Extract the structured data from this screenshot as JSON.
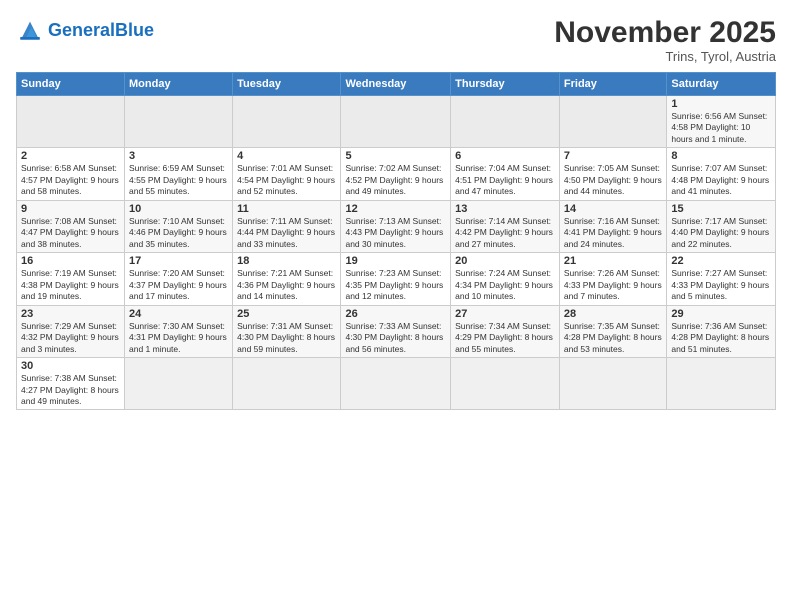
{
  "logo": {
    "line1": "General",
    "line2": "Blue"
  },
  "title": "November 2025",
  "subtitle": "Trins, Tyrol, Austria",
  "days_header": [
    "Sunday",
    "Monday",
    "Tuesday",
    "Wednesday",
    "Thursday",
    "Friday",
    "Saturday"
  ],
  "weeks": [
    [
      {
        "day": "",
        "info": ""
      },
      {
        "day": "",
        "info": ""
      },
      {
        "day": "",
        "info": ""
      },
      {
        "day": "",
        "info": ""
      },
      {
        "day": "",
        "info": ""
      },
      {
        "day": "",
        "info": ""
      },
      {
        "day": "1",
        "info": "Sunrise: 6:56 AM\nSunset: 4:58 PM\nDaylight: 10 hours\nand 1 minute."
      }
    ],
    [
      {
        "day": "2",
        "info": "Sunrise: 6:58 AM\nSunset: 4:57 PM\nDaylight: 9 hours\nand 58 minutes."
      },
      {
        "day": "3",
        "info": "Sunrise: 6:59 AM\nSunset: 4:55 PM\nDaylight: 9 hours\nand 55 minutes."
      },
      {
        "day": "4",
        "info": "Sunrise: 7:01 AM\nSunset: 4:54 PM\nDaylight: 9 hours\nand 52 minutes."
      },
      {
        "day": "5",
        "info": "Sunrise: 7:02 AM\nSunset: 4:52 PM\nDaylight: 9 hours\nand 49 minutes."
      },
      {
        "day": "6",
        "info": "Sunrise: 7:04 AM\nSunset: 4:51 PM\nDaylight: 9 hours\nand 47 minutes."
      },
      {
        "day": "7",
        "info": "Sunrise: 7:05 AM\nSunset: 4:50 PM\nDaylight: 9 hours\nand 44 minutes."
      },
      {
        "day": "8",
        "info": "Sunrise: 7:07 AM\nSunset: 4:48 PM\nDaylight: 9 hours\nand 41 minutes."
      }
    ],
    [
      {
        "day": "9",
        "info": "Sunrise: 7:08 AM\nSunset: 4:47 PM\nDaylight: 9 hours\nand 38 minutes."
      },
      {
        "day": "10",
        "info": "Sunrise: 7:10 AM\nSunset: 4:46 PM\nDaylight: 9 hours\nand 35 minutes."
      },
      {
        "day": "11",
        "info": "Sunrise: 7:11 AM\nSunset: 4:44 PM\nDaylight: 9 hours\nand 33 minutes."
      },
      {
        "day": "12",
        "info": "Sunrise: 7:13 AM\nSunset: 4:43 PM\nDaylight: 9 hours\nand 30 minutes."
      },
      {
        "day": "13",
        "info": "Sunrise: 7:14 AM\nSunset: 4:42 PM\nDaylight: 9 hours\nand 27 minutes."
      },
      {
        "day": "14",
        "info": "Sunrise: 7:16 AM\nSunset: 4:41 PM\nDaylight: 9 hours\nand 24 minutes."
      },
      {
        "day": "15",
        "info": "Sunrise: 7:17 AM\nSunset: 4:40 PM\nDaylight: 9 hours\nand 22 minutes."
      }
    ],
    [
      {
        "day": "16",
        "info": "Sunrise: 7:19 AM\nSunset: 4:38 PM\nDaylight: 9 hours\nand 19 minutes."
      },
      {
        "day": "17",
        "info": "Sunrise: 7:20 AM\nSunset: 4:37 PM\nDaylight: 9 hours\nand 17 minutes."
      },
      {
        "day": "18",
        "info": "Sunrise: 7:21 AM\nSunset: 4:36 PM\nDaylight: 9 hours\nand 14 minutes."
      },
      {
        "day": "19",
        "info": "Sunrise: 7:23 AM\nSunset: 4:35 PM\nDaylight: 9 hours\nand 12 minutes."
      },
      {
        "day": "20",
        "info": "Sunrise: 7:24 AM\nSunset: 4:34 PM\nDaylight: 9 hours\nand 10 minutes."
      },
      {
        "day": "21",
        "info": "Sunrise: 7:26 AM\nSunset: 4:33 PM\nDaylight: 9 hours\nand 7 minutes."
      },
      {
        "day": "22",
        "info": "Sunrise: 7:27 AM\nSunset: 4:33 PM\nDaylight: 9 hours\nand 5 minutes."
      }
    ],
    [
      {
        "day": "23",
        "info": "Sunrise: 7:29 AM\nSunset: 4:32 PM\nDaylight: 9 hours\nand 3 minutes."
      },
      {
        "day": "24",
        "info": "Sunrise: 7:30 AM\nSunset: 4:31 PM\nDaylight: 9 hours\nand 1 minute."
      },
      {
        "day": "25",
        "info": "Sunrise: 7:31 AM\nSunset: 4:30 PM\nDaylight: 8 hours\nand 59 minutes."
      },
      {
        "day": "26",
        "info": "Sunrise: 7:33 AM\nSunset: 4:30 PM\nDaylight: 8 hours\nand 56 minutes."
      },
      {
        "day": "27",
        "info": "Sunrise: 7:34 AM\nSunset: 4:29 PM\nDaylight: 8 hours\nand 55 minutes."
      },
      {
        "day": "28",
        "info": "Sunrise: 7:35 AM\nSunset: 4:28 PM\nDaylight: 8 hours\nand 53 minutes."
      },
      {
        "day": "29",
        "info": "Sunrise: 7:36 AM\nSunset: 4:28 PM\nDaylight: 8 hours\nand 51 minutes."
      }
    ],
    [
      {
        "day": "30",
        "info": "Sunrise: 7:38 AM\nSunset: 4:27 PM\nDaylight: 8 hours\nand 49 minutes."
      },
      {
        "day": "",
        "info": ""
      },
      {
        "day": "",
        "info": ""
      },
      {
        "day": "",
        "info": ""
      },
      {
        "day": "",
        "info": ""
      },
      {
        "day": "",
        "info": ""
      },
      {
        "day": "",
        "info": ""
      }
    ]
  ]
}
